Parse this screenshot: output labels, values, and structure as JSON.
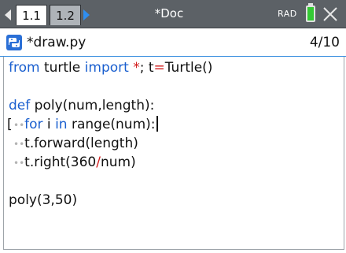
{
  "topbar": {
    "tabs": [
      {
        "label": "1.1",
        "active": true
      },
      {
        "label": "1.2",
        "active": false
      }
    ],
    "doc_title": "*Doc",
    "angle_mode": "RAD",
    "battery_color": "#34c934",
    "accent_color": "#2f8ef0"
  },
  "file": {
    "name": "*draw.py",
    "line_position": "4/10"
  },
  "code": {
    "line1": {
      "a": "from",
      "b": " turtle ",
      "c": "import",
      "d": " ",
      "e": "*",
      "f": "; t",
      "g": "=",
      "h": "Turtle()"
    },
    "line3": {
      "a": "def",
      "b": " poly(num,length):"
    },
    "line4": {
      "indent": "••",
      "a": "for",
      "b": " i ",
      "c": "in",
      "d": " range(num):"
    },
    "line5": {
      "indent": "••",
      "a": "t.forward(length)"
    },
    "line6": {
      "indent": "••",
      "a": "t.right(360",
      "b": "/",
      "c": "num)"
    },
    "line8": {
      "a": "poly(3,50)"
    }
  }
}
